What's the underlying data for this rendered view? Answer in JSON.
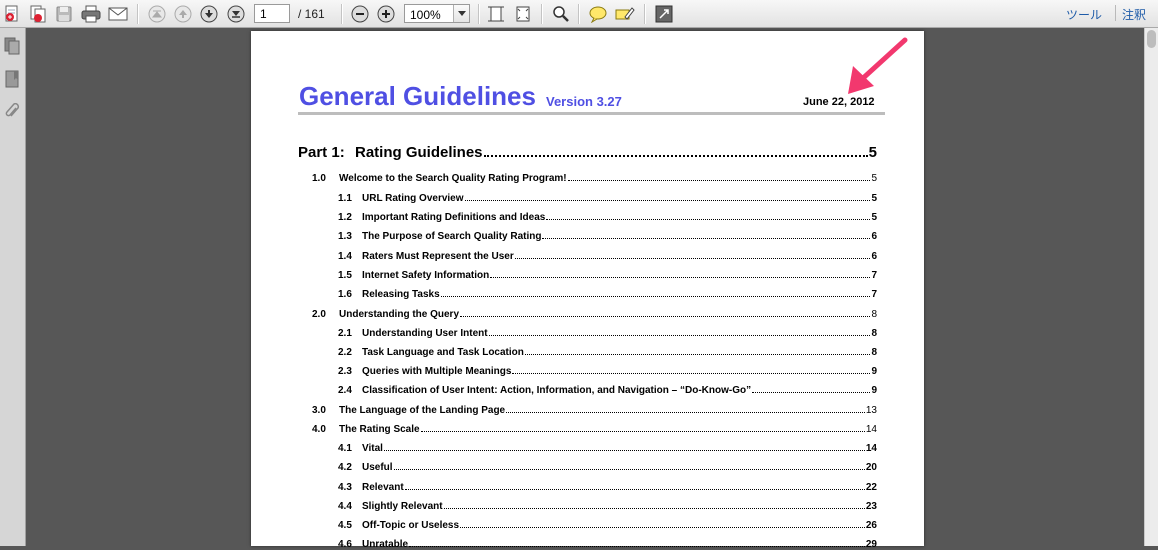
{
  "toolbar": {
    "icons": [
      "create-pdf-icon",
      "combine-files-icon",
      "save-icon",
      "print-icon",
      "email-icon",
      "first-page-icon",
      "previous-page-icon",
      "next-page-icon",
      "last-page-icon",
      "zoom-out-icon",
      "zoom-in-icon",
      "fit-width-icon",
      "fit-page-icon",
      "find-icon",
      "comment-icon",
      "highlight-icon",
      "full-screen-icon"
    ],
    "page_number": "1",
    "page_count": "/ 161",
    "zoom": "100%",
    "tools_label": "ツール",
    "comment_label": "注釈"
  },
  "left_panel": {
    "icons": [
      "page-thumbnails-icon",
      "bookmarks-icon",
      "attachments-icon"
    ]
  },
  "document": {
    "title": "General Guidelines",
    "version": "Version 3.27",
    "date": "June 22, 2012",
    "toc": [
      {
        "level": "part",
        "num": "Part 1:",
        "label": "Rating Guidelines",
        "page": "5"
      },
      {
        "level": "lvl1",
        "num": "1.0",
        "label": "Welcome to the Search Quality Rating Program!",
        "page": "5"
      },
      {
        "level": "lvl2",
        "num": "1.1",
        "label": "URL Rating Overview",
        "page": "5"
      },
      {
        "level": "lvl2",
        "num": "1.2",
        "label": "Important Rating Definitions and Ideas",
        "page": "5"
      },
      {
        "level": "lvl2",
        "num": "1.3",
        "label": "The Purpose of Search Quality Rating",
        "page": "6"
      },
      {
        "level": "lvl2",
        "num": "1.4",
        "label": "Raters Must Represent the User",
        "page": "6"
      },
      {
        "level": "lvl2",
        "num": "1.5",
        "label": "Internet Safety Information",
        "page": "7"
      },
      {
        "level": "lvl2",
        "num": "1.6",
        "label": "Releasing Tasks",
        "page": "7"
      },
      {
        "level": "lvl1",
        "num": "2.0",
        "label": "Understanding the Query",
        "page": "8"
      },
      {
        "level": "lvl2",
        "num": "2.1",
        "label": "Understanding User Intent",
        "page": "8"
      },
      {
        "level": "lvl2",
        "num": "2.2",
        "label": "Task Language and Task Location",
        "page": "8"
      },
      {
        "level": "lvl2",
        "num": "2.3",
        "label": "Queries with Multiple Meanings",
        "page": "9"
      },
      {
        "level": "lvl2",
        "num": "2.4",
        "label": "Classification of User Intent:  Action, Information, and Navigation – “Do-Know-Go”",
        "page": "9"
      },
      {
        "level": "lvl1",
        "num": "3.0",
        "label": "The Language of the Landing Page",
        "page": "13"
      },
      {
        "level": "lvl1",
        "num": "4.0",
        "label": "The Rating Scale",
        "page": "14"
      },
      {
        "level": "lvl2",
        "num": "4.1",
        "label": "Vital",
        "page": "14"
      },
      {
        "level": "lvl2",
        "num": "4.2",
        "label": "Useful",
        "page": "20"
      },
      {
        "level": "lvl2",
        "num": "4.3",
        "label": "Relevant",
        "page": "22"
      },
      {
        "level": "lvl2",
        "num": "4.4",
        "label": "Slightly Relevant",
        "page": "23"
      },
      {
        "level": "lvl2",
        "num": "4.5",
        "label": "Off-Topic or Useless",
        "page": "26"
      },
      {
        "level": "lvl2",
        "num": "4.6",
        "label": "Unratable",
        "page": "29"
      }
    ]
  },
  "colors": {
    "title": "#4f4fe3",
    "annotation_arrow": "#f2386e",
    "link": "#1e5ba8"
  }
}
